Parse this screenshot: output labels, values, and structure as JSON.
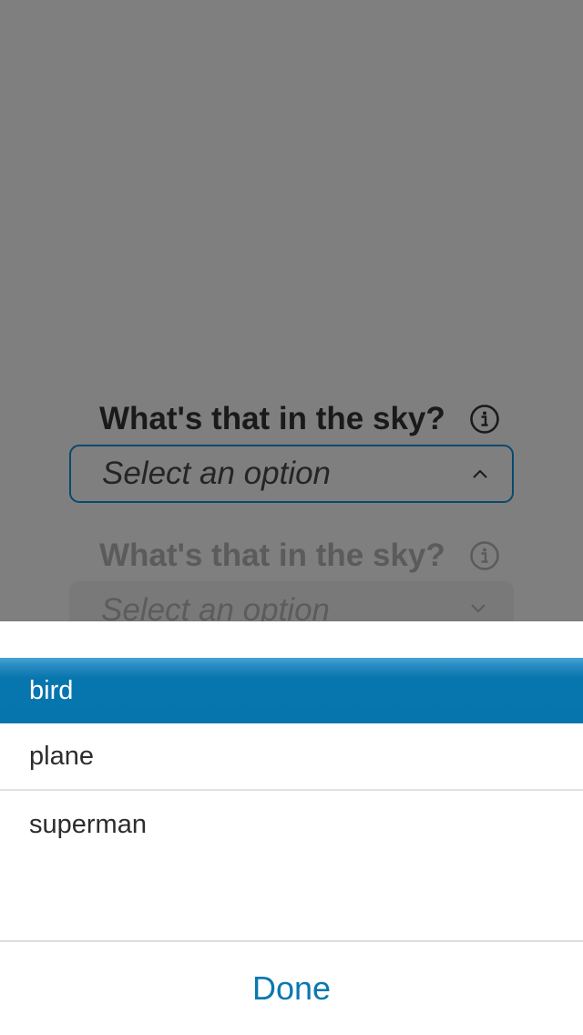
{
  "form": {
    "field_1": {
      "label": "What's that in the sky?",
      "info_icon": "info-icon",
      "placeholder": "Select an option",
      "chevron_icon": "chevron-up-icon",
      "state": "open"
    },
    "field_2": {
      "label": "What's that in the sky?",
      "info_icon": "info-icon",
      "placeholder": "Select an option",
      "chevron_icon": "chevron-down-icon",
      "state": "disabled"
    }
  },
  "picker": {
    "options": [
      "bird",
      "plane",
      "superman"
    ],
    "selected": "bird",
    "done_label": "Done"
  },
  "colors": {
    "overlay": "#7f7f7f",
    "accent": "#0675ae",
    "done_text": "#0a78b0",
    "selected_text": "#ffffff"
  }
}
